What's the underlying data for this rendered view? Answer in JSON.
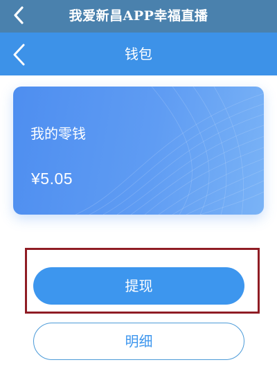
{
  "app_bar": {
    "title": "我爱新昌APP幸福直播",
    "icon": "chevron-left-icon"
  },
  "nav_bar": {
    "title": "钱包",
    "icon": "chevron-left-icon"
  },
  "wallet_card": {
    "label": "我的零钱",
    "amount": "¥5.05"
  },
  "buttons": {
    "withdraw_label": "提现",
    "details_label": "明细"
  },
  "colors": {
    "app_bar_bg": "#4a81ad",
    "nav_bar_bg": "#3d92e8",
    "card_bg": "#5f9cf3",
    "button_blue": "#3d96ee",
    "highlight_border": "#8f1c24"
  }
}
